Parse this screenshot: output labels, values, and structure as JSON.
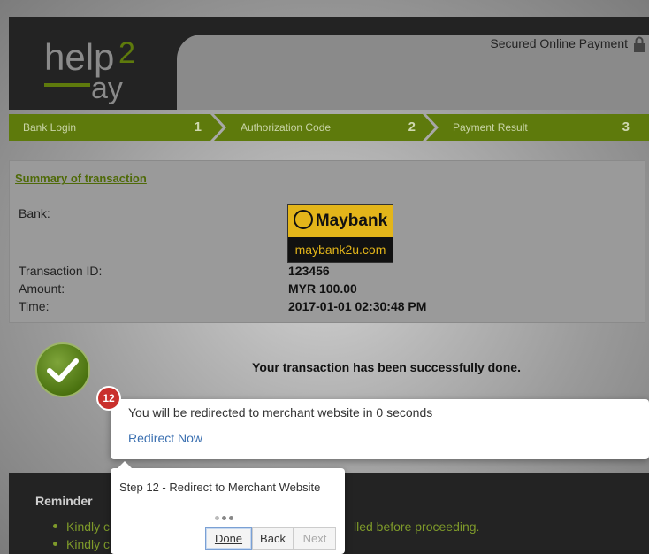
{
  "header": {
    "logo_text_top": "help",
    "logo_num": "2",
    "logo_text_bottom": "pay",
    "secured_label": "Secured Online Payment"
  },
  "steps": [
    {
      "label": "Bank Login",
      "num": "1"
    },
    {
      "label": "Authorization Code",
      "num": "2"
    },
    {
      "label": "Payment Result",
      "num": "3"
    }
  ],
  "summary": {
    "title": "Summary of transaction",
    "bank_label": "Bank:",
    "bank_logo_name": "Maybank",
    "bank_logo_url_text": "maybank2u.com",
    "txn_id_label": "Transaction ID:",
    "txn_id": "123456",
    "amount_label": "Amount:",
    "amount": "MYR 100.00",
    "time_label": "Time:",
    "time": "2017-01-01 02:30:48 PM"
  },
  "success_message": "Your transaction has been successfully done.",
  "popup": {
    "badge": "12",
    "message": "You will be redirected to merchant website in 0 seconds",
    "link": "Redirect Now"
  },
  "tour": {
    "title": "Step 12 - Redirect to Merchant Website",
    "done": "Done",
    "back": "Back",
    "next": "Next"
  },
  "reminder": {
    "title": "Reminder",
    "item1_start": "Kindly c",
    "item1_end": "lled before proceeding.",
    "item2_start": "Kindly c"
  },
  "colors": {
    "accent_green": "#5e7a0c",
    "header_dark": "#232323",
    "badge_red": "#c9302c",
    "link_blue": "#3a6fb0"
  }
}
